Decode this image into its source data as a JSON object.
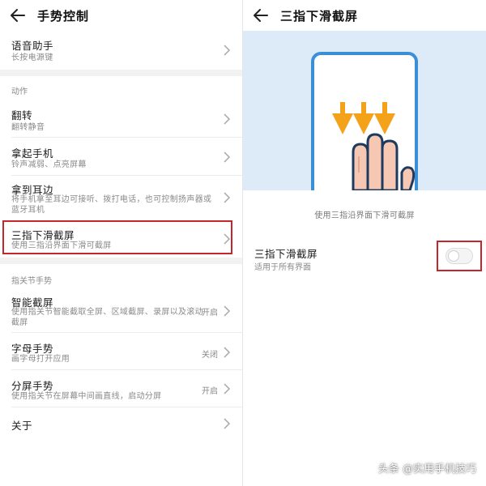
{
  "left": {
    "title": "手势控制",
    "voice": {
      "label": "语音助手",
      "sub": "长按电源键"
    },
    "section_actions": "动作",
    "flip": {
      "label": "翻转",
      "sub": "翻转静音"
    },
    "pickup": {
      "label": "拿起手机",
      "sub": "铃声减弱、点亮屏幕"
    },
    "ear": {
      "label": "拿到耳边",
      "sub": "将手机拿至耳边可接听、拨打电话，也可控制扬声器或蓝牙耳机"
    },
    "three_finger": {
      "label": "三指下滑截屏",
      "sub": "使用三指沿界面下滑可截屏"
    },
    "section_knuckle": "指关节手势",
    "smart": {
      "label": "智能截屏",
      "sub": "使用指关节智能截取全屏、区域截屏、录屏以及滚动截屏",
      "status": "开启"
    },
    "letter": {
      "label": "字母手势",
      "sub": "画字母打开应用",
      "status": "关闭"
    },
    "split": {
      "label": "分屏手势",
      "sub": "使用指关节在屏幕中间画直线，启动分屏",
      "status": "开启"
    },
    "about": {
      "label": "关于"
    }
  },
  "right": {
    "title": "三指下滑截屏",
    "caption": "使用三指沿界面下滑可截屏",
    "setting": {
      "label": "三指下滑截屏",
      "sub": "适用于所有界面",
      "enabled": false
    }
  },
  "watermark": "头条 @实用手机技巧",
  "colors": {
    "highlight": "#c4262c",
    "illustration_bg": "#dcebf7",
    "arrow": "#f3a21a",
    "phone_frame": "#3b8fd6"
  }
}
